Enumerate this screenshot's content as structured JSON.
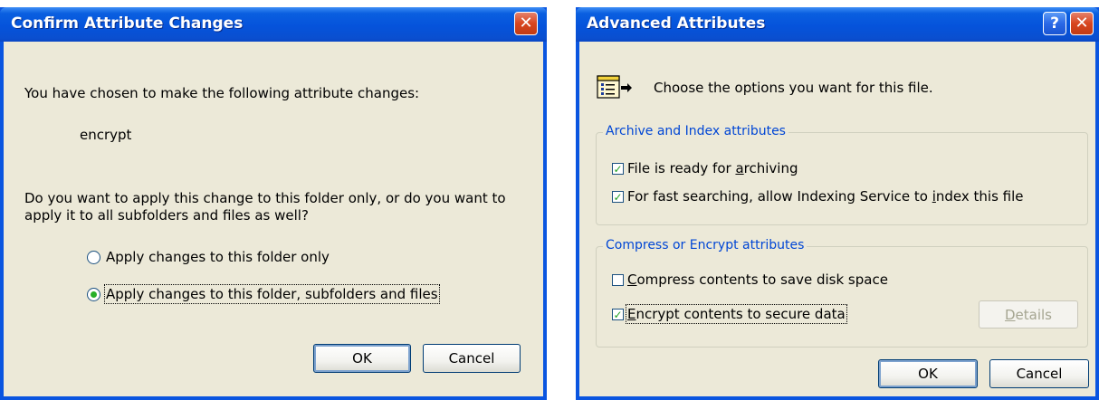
{
  "confirm_dialog": {
    "title": "Confirm Attribute Changes",
    "message": "You have chosen to make the following attribute changes:",
    "change": "encrypt",
    "question_line1": "Do you want to apply this change to this folder only, or do you want to",
    "question_line2": "apply it to all subfolders and files as well?",
    "options": [
      {
        "label": "Apply changes to this folder only",
        "selected": false
      },
      {
        "label": "Apply changes to this folder, subfolders and files",
        "selected": true
      }
    ],
    "ok_label": "OK",
    "cancel_label": "Cancel"
  },
  "advanced_dialog": {
    "title": "Advanced Attributes",
    "help_glyph": "?",
    "icon": "file-properties-icon",
    "description": "Choose the options you want for this file.",
    "archive_group": {
      "label": "Archive and Index attributes",
      "items": [
        {
          "pre": "File is ready for ",
          "accel": "a",
          "post": "rchiving",
          "checked": true
        },
        {
          "pre": "For fast searching, allow Indexing Service to ",
          "accel": "i",
          "post": "ndex this file",
          "checked": true
        }
      ]
    },
    "compress_group": {
      "label": "Compress or Encrypt attributes",
      "items": [
        {
          "pre": "",
          "accel": "C",
          "post": "ompress contents to save disk space",
          "checked": false
        },
        {
          "pre": "",
          "accel": "E",
          "post": "ncrypt contents to secure data",
          "checked": true
        }
      ],
      "details_accel": "D",
      "details_rest": "etails"
    },
    "ok_label": "OK",
    "cancel_label": "Cancel"
  },
  "colors": {
    "titlebar": "#0a55e0",
    "client": "#ece9d8",
    "group_label": "#0046d5",
    "close_button": "#d8451f"
  }
}
